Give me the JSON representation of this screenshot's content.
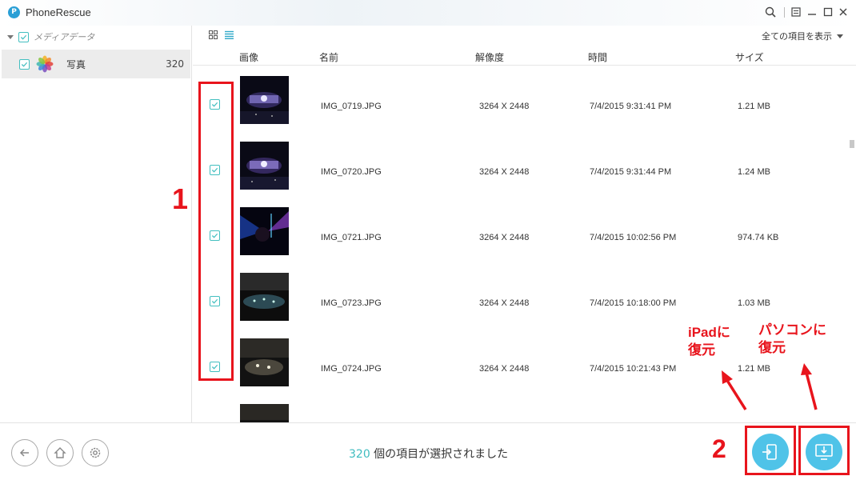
{
  "app": {
    "title": "PhoneRescue",
    "logo_letter": "P"
  },
  "sidebar": {
    "root_label": "メディアデータ",
    "items": [
      {
        "label": "写真",
        "count": "320"
      }
    ]
  },
  "toolbar": {
    "filter_label": "全ての項目を表示"
  },
  "table": {
    "headers": {
      "image": "画像",
      "name": "名前",
      "resolution": "解像度",
      "time": "時間",
      "size": "サイズ"
    },
    "rows": [
      {
        "name": "IMG_0719.JPG",
        "resolution": "3264 X 2448",
        "time": "7/4/2015 9:31:41 PM",
        "size": "1.21 MB",
        "checked": true
      },
      {
        "name": "IMG_0720.JPG",
        "resolution": "3264 X 2448",
        "time": "7/4/2015 9:31:44 PM",
        "size": "1.24 MB",
        "checked": true
      },
      {
        "name": "IMG_0721.JPG",
        "resolution": "3264 X 2448",
        "time": "7/4/2015 10:02:56 PM",
        "size": "974.74 KB",
        "checked": true
      },
      {
        "name": "IMG_0723.JPG",
        "resolution": "3264 X 2448",
        "time": "7/4/2015 10:18:00 PM",
        "size": "1.03 MB",
        "checked": true
      },
      {
        "name": "IMG_0724.JPG",
        "resolution": "3264 X 2448",
        "time": "7/4/2015 10:21:43 PM",
        "size": "1.21 MB",
        "checked": true
      }
    ]
  },
  "footer": {
    "selected_count": "320",
    "selected_suffix": " 個の項目が選択されました"
  },
  "annotations": {
    "step1": "1",
    "step2": "2",
    "to_ipad_line1": "iPadに",
    "to_ipad_line2": "復元",
    "to_pc_line1": "パソコンに",
    "to_pc_line2": "復元"
  },
  "colors": {
    "accent": "#3fbcbf",
    "annotation": "#e8141c",
    "action": "#4fc3e8"
  }
}
